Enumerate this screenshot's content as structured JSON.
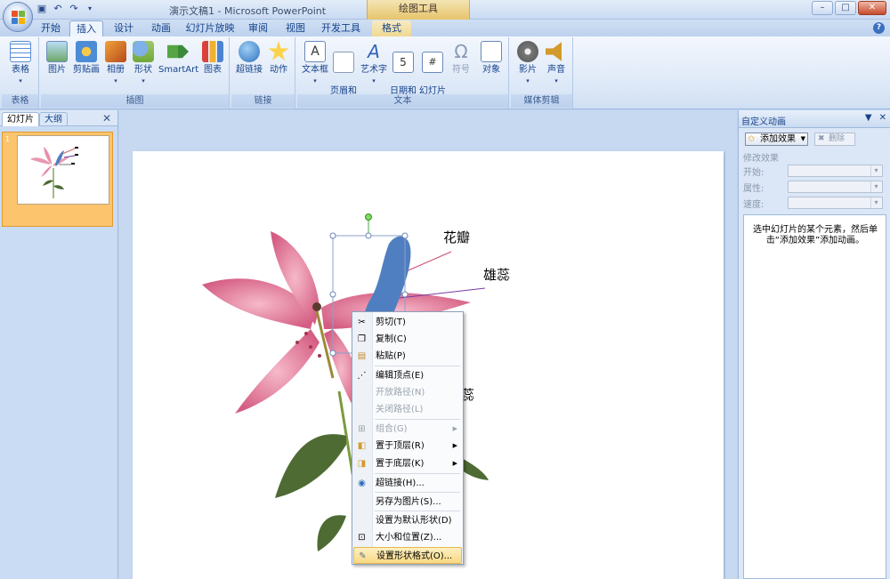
{
  "window": {
    "title": "演示文稿1 - Microsoft PowerPoint",
    "contextual_tab_group": "绘图工具"
  },
  "window_controls": [
    "–",
    "□",
    "✕"
  ],
  "tabs": [
    "开始",
    "插入",
    "设计",
    "动画",
    "幻灯片放映",
    "审阅",
    "视图",
    "开发工具",
    "格式"
  ],
  "active_tab": "插入",
  "ribbon": {
    "groups": [
      {
        "label": "表格",
        "buttons": [
          "表格"
        ]
      },
      {
        "label": "插图",
        "buttons": [
          "图片",
          "剪贴画",
          "相册",
          "形状",
          "SmartArt",
          "图表"
        ]
      },
      {
        "label": "链接",
        "buttons": [
          "超链接",
          "动作"
        ]
      },
      {
        "label": "文本",
        "buttons": [
          "文本框",
          "页眉和\n页脚",
          "艺术字",
          "日期和\n时间",
          "幻灯片\n编号",
          "符号",
          "对象"
        ]
      },
      {
        "label": "媒体剪辑",
        "buttons": [
          "影片",
          "声音"
        ]
      }
    ]
  },
  "slides_pane": {
    "tabs": [
      "幻灯片",
      "大纲"
    ],
    "slide_number": "1"
  },
  "slide_labels": {
    "petal": "花瓣",
    "stamen": "雄蕊",
    "pistil_partial": "雌蕊"
  },
  "context_menu": {
    "items": [
      {
        "label": "剪切(T)",
        "icon": "scissors-icon",
        "disabled": false
      },
      {
        "label": "复制(C)",
        "icon": "copy-icon",
        "disabled": false
      },
      {
        "label": "粘贴(P)",
        "icon": "paste-icon",
        "disabled": false
      },
      {
        "label": "编辑顶点(E)",
        "icon": "edit-points-icon",
        "disabled": false
      },
      {
        "label": "开放路径(N)",
        "icon": "",
        "disabled": true
      },
      {
        "label": "关闭路径(L)",
        "icon": "",
        "disabled": true
      },
      {
        "label": "组合(G)",
        "icon": "group-icon",
        "disabled": true,
        "submenu": true
      },
      {
        "label": "置于顶层(R)",
        "icon": "bring-front-icon",
        "disabled": false,
        "submenu": true
      },
      {
        "label": "置于底层(K)",
        "icon": "send-back-icon",
        "disabled": false,
        "submenu": true
      },
      {
        "label": "超链接(H)...",
        "icon": "hyperlink-icon",
        "disabled": false
      },
      {
        "label": "另存为图片(S)...",
        "icon": "",
        "disabled": false
      },
      {
        "label": "设置为默认形状(D)",
        "icon": "",
        "disabled": false
      },
      {
        "label": "大小和位置(Z)...",
        "icon": "size-position-icon",
        "disabled": false
      },
      {
        "label": "设置形状格式(O)...",
        "icon": "format-shape-icon",
        "disabled": false,
        "highlighted": true
      }
    ]
  },
  "task_pane": {
    "title": "自定义动画",
    "add_effect": "添加效果",
    "remove": "删除",
    "modify_section": "修改效果",
    "fields": [
      "开始:",
      "属性:",
      "速度:"
    ],
    "hint": "选中幻灯片的某个元素，然后单击“添加效果”添加动画。"
  },
  "colors": {
    "selection_shape": "#4f7fc1",
    "accent_ribbon": "#dbe7f7",
    "highlight": "#f8d985"
  }
}
